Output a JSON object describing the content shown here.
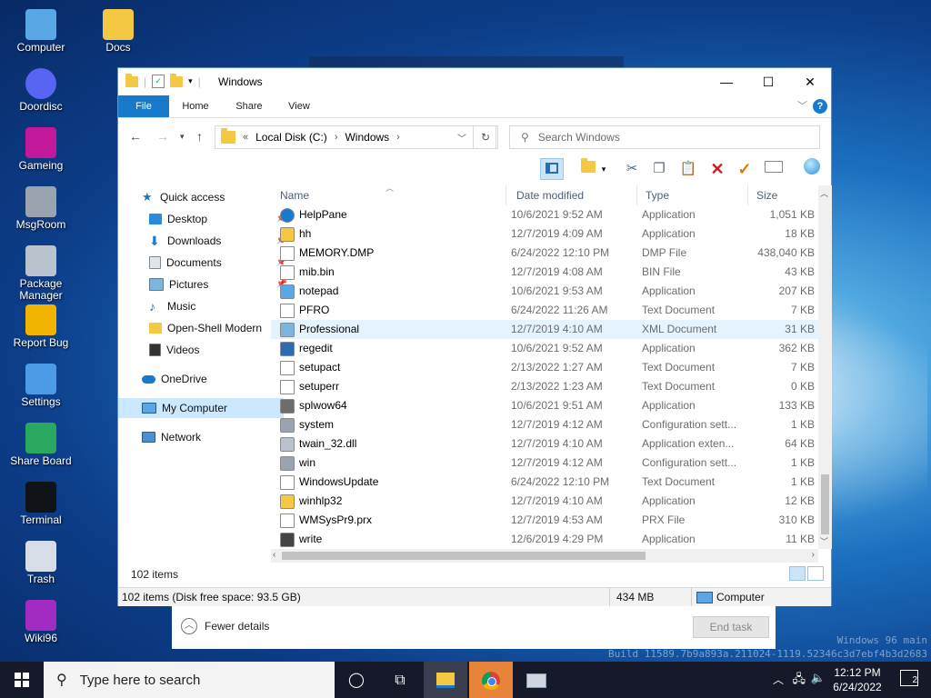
{
  "desktop": {
    "icons": [
      {
        "label": "Computer",
        "icon": "computer-icon"
      },
      {
        "label": "Docs",
        "icon": "folder-icon"
      },
      {
        "label": "Doordisc",
        "icon": "discord-icon"
      },
      {
        "label": "Gameing",
        "icon": "game-icon"
      },
      {
        "label": "MsgRoom",
        "icon": "msgroom-icon"
      },
      {
        "label": "Package Manager",
        "icon": "package-icon"
      },
      {
        "label": "Report Bug",
        "icon": "shield-icon"
      },
      {
        "label": "Settings",
        "icon": "settings-icon"
      },
      {
        "label": "Share Board",
        "icon": "shareboard-icon"
      },
      {
        "label": "Terminal",
        "icon": "terminal-icon"
      },
      {
        "label": "Trash",
        "icon": "trash-icon"
      },
      {
        "label": "Wiki96",
        "icon": "wiki-icon"
      }
    ],
    "watermark_line1": "Windows 96 main",
    "watermark_line2": "Build 11589.7b9a893a.211024-1119.52346c3d7ebf4b3d2683"
  },
  "task_manager": {
    "fewer_details": "Fewer details",
    "end_task": "End task"
  },
  "explorer": {
    "title": "Windows",
    "tabs": [
      "File",
      "Home",
      "Share",
      "View"
    ],
    "help": "?",
    "breadcrumb": {
      "prefix": "«",
      "items": [
        "Local Disk (C:)",
        "Windows"
      ]
    },
    "search_placeholder": "Search Windows",
    "nav": {
      "quick_access": "Quick access",
      "items": [
        "Desktop",
        "Downloads",
        "Documents",
        "Pictures",
        "Music",
        "Open-Shell Modern",
        "Videos"
      ],
      "onedrive": "OneDrive",
      "my_computer": "My Computer",
      "network": "Network"
    },
    "columns": {
      "name": "Name",
      "date": "Date modified",
      "type": "Type",
      "size": "Size"
    },
    "files": [
      {
        "name": "HelpPane",
        "date": "10/6/2021 9:52 AM",
        "type": "Application",
        "size": "1,051 KB"
      },
      {
        "name": "hh",
        "date": "12/7/2019 4:09 AM",
        "type": "Application",
        "size": "18 KB"
      },
      {
        "name": "MEMORY.DMP",
        "date": "6/24/2022 12:10 PM",
        "type": "DMP File",
        "size": "438,040 KB"
      },
      {
        "name": "mib.bin",
        "date": "12/7/2019 4:08 AM",
        "type": "BIN File",
        "size": "43 KB"
      },
      {
        "name": "notepad",
        "date": "10/6/2021 9:53 AM",
        "type": "Application",
        "size": "207 KB"
      },
      {
        "name": "PFRO",
        "date": "6/24/2022 11:26 AM",
        "type": "Text Document",
        "size": "7 KB"
      },
      {
        "name": "Professional",
        "date": "12/7/2019 4:10 AM",
        "type": "XML Document",
        "size": "31 KB"
      },
      {
        "name": "regedit",
        "date": "10/6/2021 9:52 AM",
        "type": "Application",
        "size": "362 KB"
      },
      {
        "name": "setupact",
        "date": "2/13/2022 1:27 AM",
        "type": "Text Document",
        "size": "7 KB"
      },
      {
        "name": "setuperr",
        "date": "2/13/2022 1:23 AM",
        "type": "Text Document",
        "size": "0 KB"
      },
      {
        "name": "splwow64",
        "date": "10/6/2021 9:51 AM",
        "type": "Application",
        "size": "133 KB"
      },
      {
        "name": "system",
        "date": "12/7/2019 4:12 AM",
        "type": "Configuration sett...",
        "size": "1 KB"
      },
      {
        "name": "twain_32.dll",
        "date": "12/7/2019 4:10 AM",
        "type": "Application exten...",
        "size": "64 KB"
      },
      {
        "name": "win",
        "date": "12/7/2019 4:12 AM",
        "type": "Configuration sett...",
        "size": "1 KB"
      },
      {
        "name": "WindowsUpdate",
        "date": "6/24/2022 12:10 PM",
        "type": "Text Document",
        "size": "1 KB"
      },
      {
        "name": "winhlp32",
        "date": "12/7/2019 4:10 AM",
        "type": "Application",
        "size": "12 KB"
      },
      {
        "name": "WMSysPr9.prx",
        "date": "12/7/2019 4:53 AM",
        "type": "PRX File",
        "size": "310 KB"
      },
      {
        "name": "write",
        "date": "12/6/2019 4:29 PM",
        "type": "Application",
        "size": "11 KB"
      }
    ],
    "item_count": "102 items",
    "status": {
      "left": "102 items (Disk free space: 93.5 GB)",
      "mid": "434 MB",
      "right": "Computer"
    }
  },
  "taskbar": {
    "search_placeholder": "Type here to search",
    "time": "12:12 PM",
    "date": "6/24/2022",
    "notifications": "2"
  }
}
